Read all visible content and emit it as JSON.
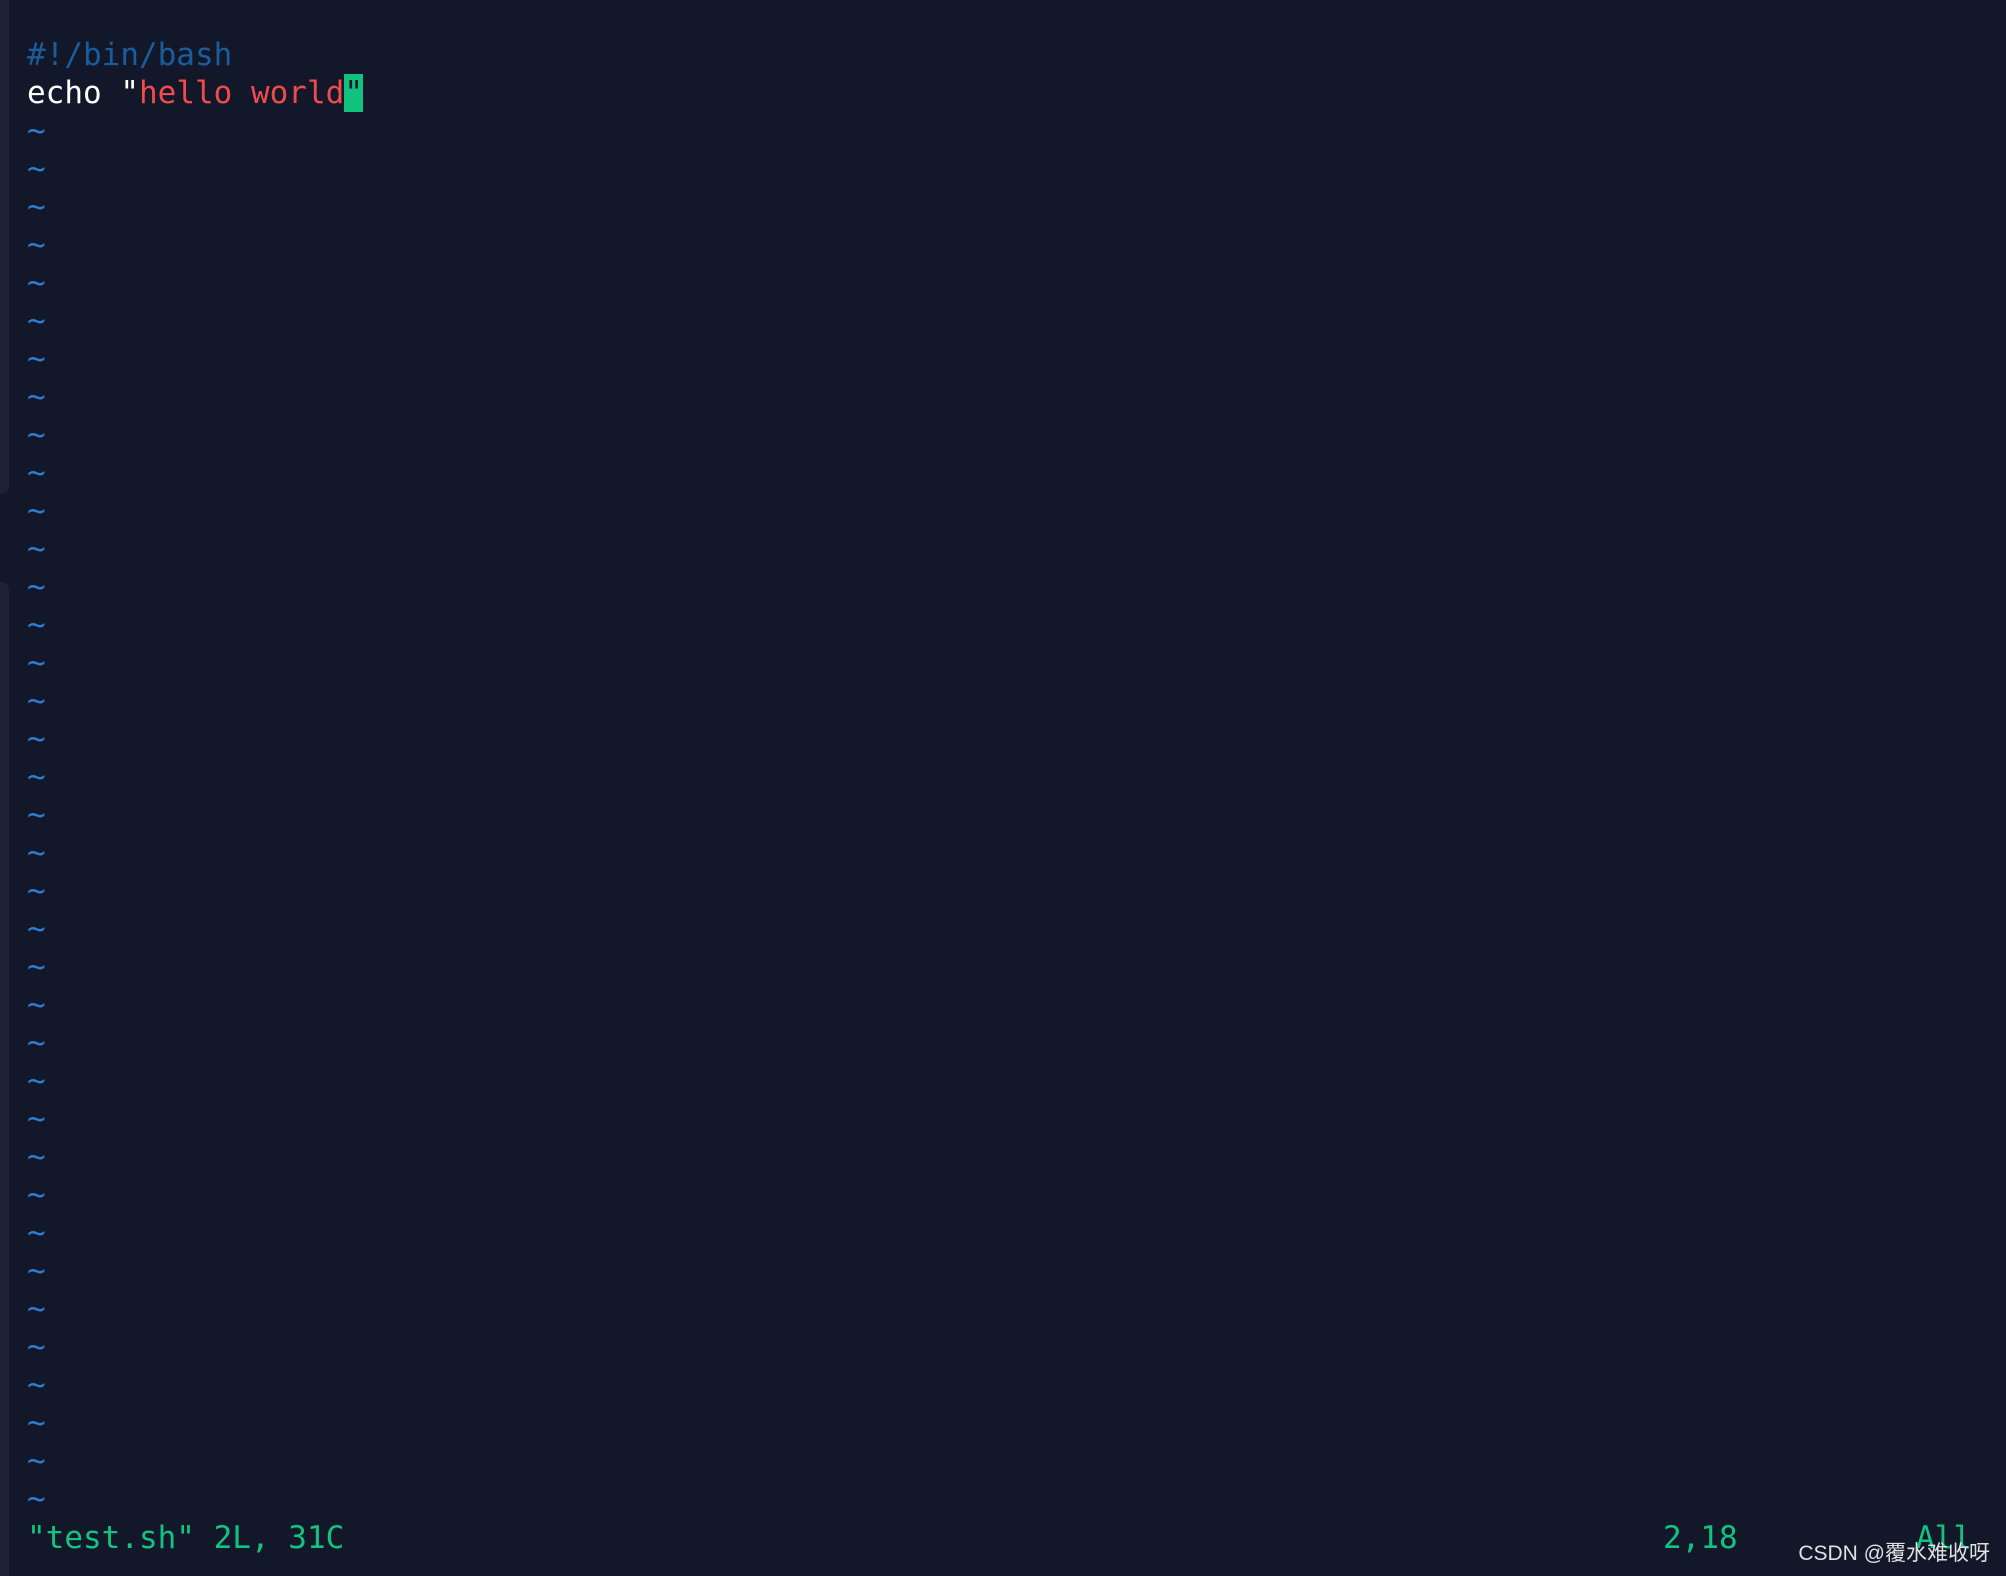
{
  "editor": {
    "lines": {
      "shebang": "#!/bin/bash",
      "echo_cmd": "echo ",
      "echo_quote_open": "\"",
      "echo_string": "hello world",
      "cursor_char": "\""
    },
    "empty_line_marker": "~",
    "colors": {
      "background": "#13172a",
      "comment": "#1b5c9c",
      "string": "#ef4b4b",
      "text": "#ffffff",
      "cursor": "#10c27e",
      "tilde": "#2c7fd0",
      "status": "#12c47f"
    }
  },
  "statusline": {
    "message": "\"test.sh\" 2L, 31C",
    "position": "2,18",
    "scroll": "All"
  },
  "watermark": "CSDN @覆水难收呀"
}
